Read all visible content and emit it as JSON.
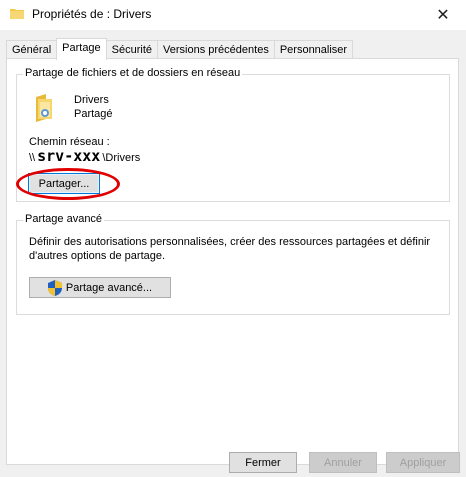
{
  "window": {
    "title": "Propriétés de : Drivers",
    "close_glyph": "✕"
  },
  "tabs": [
    {
      "label": "Général"
    },
    {
      "label": "Partage"
    },
    {
      "label": "Sécurité"
    },
    {
      "label": "Versions précédentes"
    },
    {
      "label": "Personnaliser"
    }
  ],
  "sharing_group": {
    "label": "Partage de fichiers et de dossiers en réseau",
    "folder_name": "Drivers",
    "status": "Partagé",
    "network_path_label": "Chemin réseau :",
    "path_prefix": "\\\\",
    "server_name": "srv-xxx",
    "path_suffix": "\\Drivers",
    "share_button": "Partager..."
  },
  "advanced_group": {
    "label": "Partage avancé",
    "description": "Définir des autorisations personnalisées, créer des ressources partagées et définir d'autres options de partage.",
    "button": "Partage avancé..."
  },
  "footer": {
    "close": "Fermer",
    "cancel": "Annuler",
    "apply": "Appliquer"
  },
  "colors": {
    "highlight": "#e00000",
    "focus": "#0078d7",
    "folder": "#f2c94c"
  }
}
